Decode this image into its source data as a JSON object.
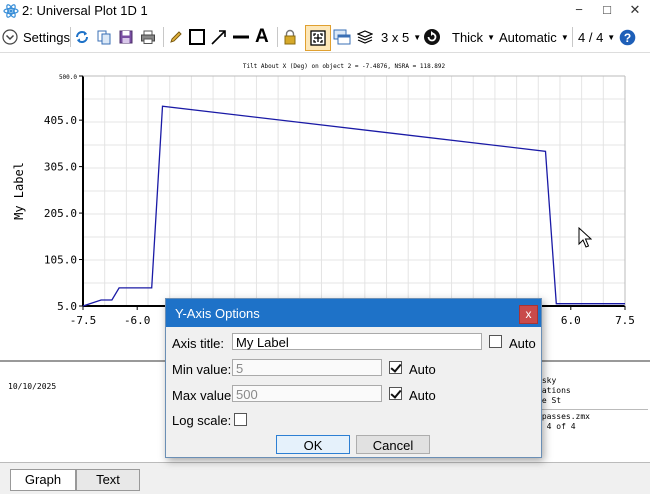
{
  "window": {
    "title": "2: Universal Plot 1D 1"
  },
  "toolbar": {
    "settings_label": "Settings",
    "layout_label": "3 x 5",
    "line_width_label": "Thick",
    "scale_label": "Automatic",
    "page_label": "4 / 4"
  },
  "chart_data": {
    "type": "line",
    "title": "Tilt About X (Deg) on object 2 = -7.4876, NSRA = 118.892",
    "xlabel": "",
    "ylabel": "My Label",
    "xlim": [
      -7.5,
      7.5
    ],
    "ylim": [
      5,
      500
    ],
    "x_ticks": [
      "-7.5",
      "-6.0",
      "6.0",
      "7.5"
    ],
    "y_ticks": [
      "5.0",
      "105.0",
      "205.0",
      "305.0",
      "405.0",
      "500.0"
    ],
    "series": [
      {
        "color": "#1a1aa6",
        "x": [
          -7.5,
          -7.0,
          -6.7,
          -6.5,
          -5.6,
          -5.3,
          5.3,
          5.6,
          5.9,
          7.5
        ],
        "y": [
          5,
          18,
          18,
          44,
          44,
          435,
          338,
          10,
          10,
          10
        ]
      }
    ]
  },
  "info": {
    "date": "10/10/2025",
    "right_lines": [
      "nsky",
      "rations",
      "te St",
      ".passes.zmx",
      "n 4 of 4"
    ]
  },
  "tabs": {
    "graph": "Graph",
    "text": "Text"
  },
  "dialog": {
    "title": "Y-Axis Options",
    "close_glyph": "x",
    "axis_title_label": "Axis title:",
    "axis_title_value": "My Label",
    "axis_title_auto_checked": false,
    "min_label": "Min value:",
    "min_value": "5",
    "min_auto_checked": true,
    "max_label": "Max value:",
    "max_value": "500",
    "max_auto_checked": true,
    "log_label": "Log scale:",
    "log_checked": false,
    "auto_label": "Auto",
    "ok_label": "OK",
    "cancel_label": "Cancel"
  }
}
